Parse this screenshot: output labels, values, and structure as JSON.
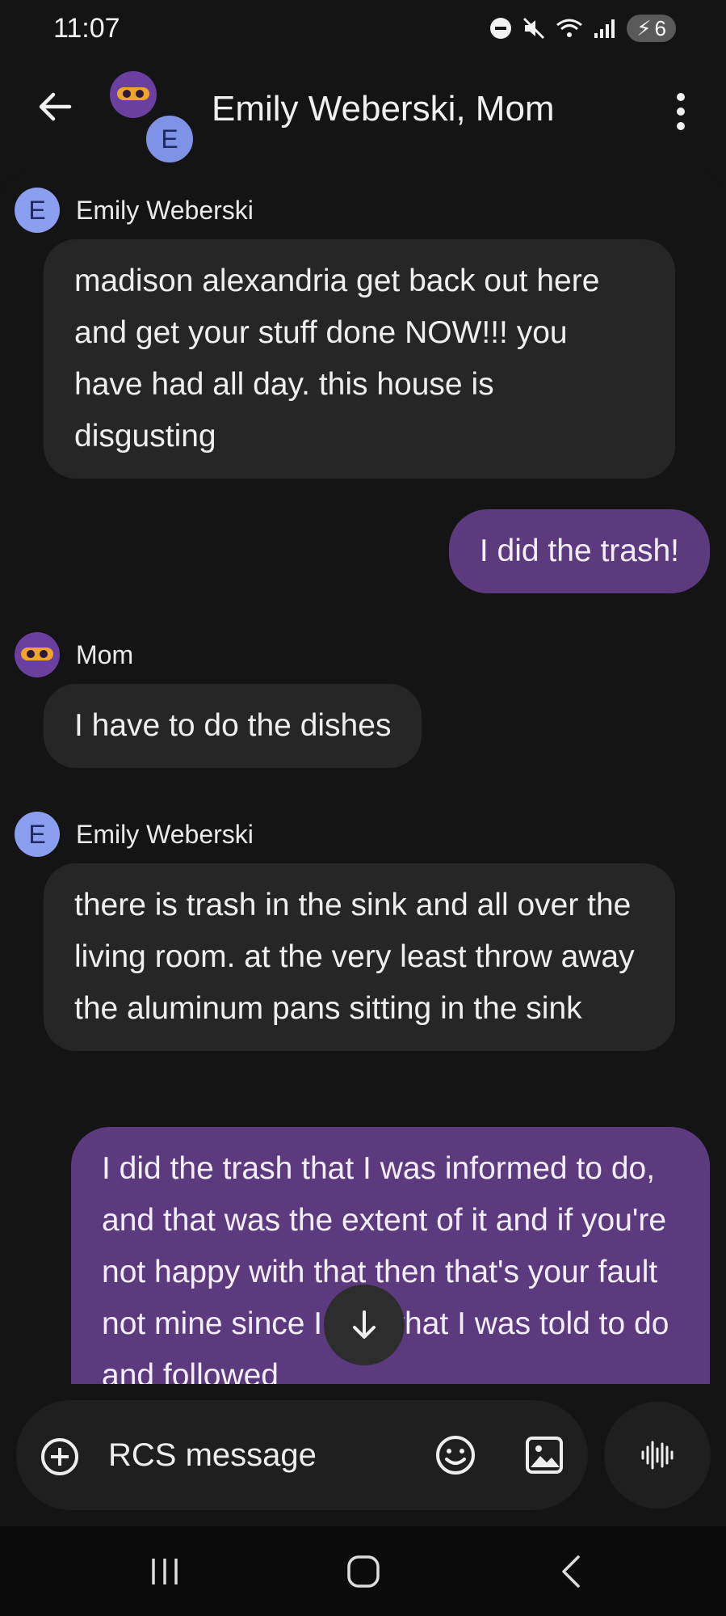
{
  "status_bar": {
    "time": "11:07",
    "battery": "6"
  },
  "header": {
    "title": "Emily Weberski, Mom",
    "avatar_letter": "E"
  },
  "messages": [
    {
      "sender": "Emily Weberski",
      "avatar_letter": "E",
      "text": "madison alexandria get back out here and get your stuff done NOW!!! you have had all day. this house is disgusting"
    },
    {
      "sender": "me",
      "text": "I did the trash!"
    },
    {
      "sender": "Mom",
      "text": "I have to do the dishes"
    },
    {
      "sender": "Emily Weberski",
      "avatar_letter": "E",
      "text": "there is trash in the sink and all over the living room. at the very least throw away the aluminum pans sitting in the sink"
    },
    {
      "sender": "me",
      "text": "I did the trash that I was informed to do, and that was the extent of it and if you're not happy with that then that's your fault not mine since I did what I was told to do and followed"
    }
  ],
  "composer": {
    "placeholder": "RCS message"
  },
  "icons": [
    "back-arrow-icon",
    "more-vert-icon",
    "add-circle-icon",
    "emoji-icon",
    "image-icon",
    "voice-icon",
    "arrow-down-icon",
    "recents-icon",
    "home-icon",
    "nav-back-icon"
  ]
}
